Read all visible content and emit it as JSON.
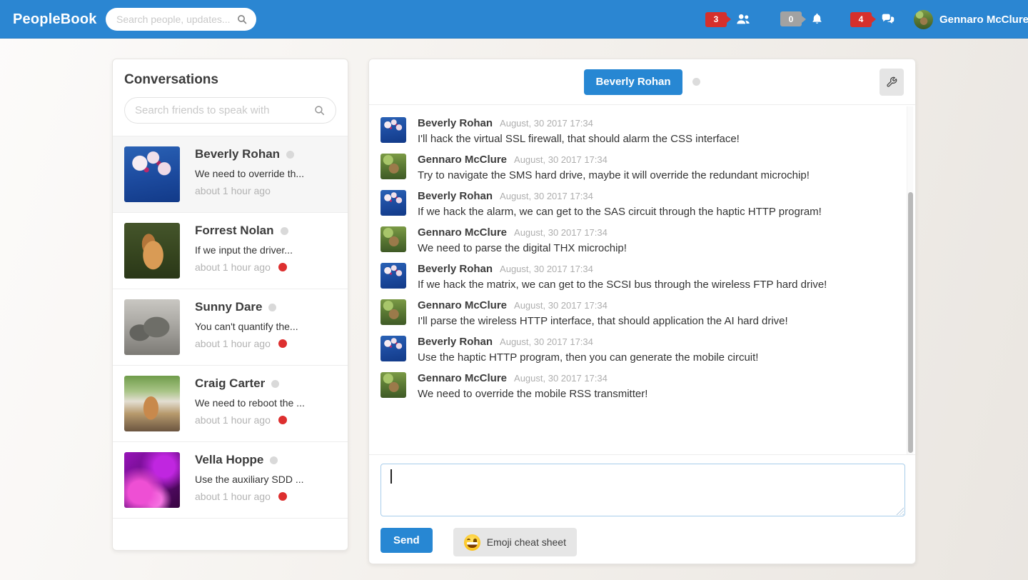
{
  "navbar": {
    "brand": "PeopleBook",
    "search_placeholder": "Search people, updates...",
    "badges": [
      {
        "count": "3",
        "icon": "users-icon",
        "color": "#d6302c"
      },
      {
        "count": "0",
        "icon": "bell-icon",
        "color": "#a2a2a2"
      },
      {
        "count": "4",
        "icon": "chat-icon",
        "color": "#d6302c"
      }
    ],
    "user": {
      "name": "Gennaro McClure",
      "avatar": "turtle"
    }
  },
  "conversations": {
    "title": "Conversations",
    "search_placeholder": "Search friends to speak with",
    "items": [
      {
        "name": "Beverly Rohan",
        "avatar": "orchid",
        "preview": "We need to override th...",
        "time": "about 1 hour ago",
        "unread": false,
        "selected": true
      },
      {
        "name": "Forrest Nolan",
        "avatar": "horse",
        "preview": "If we input the driver...",
        "time": "about 1 hour ago",
        "unread": true,
        "selected": false
      },
      {
        "name": "Sunny Dare",
        "avatar": "rhino",
        "preview": "You can't quantify the...",
        "time": "about 1 hour ago",
        "unread": true,
        "selected": false
      },
      {
        "name": "Craig Carter",
        "avatar": "dog",
        "preview": "We need to reboot the ...",
        "time": "about 1 hour ago",
        "unread": true,
        "selected": false
      },
      {
        "name": "Vella Hoppe",
        "avatar": "purple",
        "preview": "Use the auxiliary SDD ...",
        "time": "about 1 hour ago",
        "unread": true,
        "selected": false
      }
    ]
  },
  "chat": {
    "peer_name": "Beverly Rohan",
    "messages": [
      {
        "author": "Beverly Rohan",
        "avatar": "orchid",
        "timestamp": "August, 30 2017 17:34",
        "text": "I'll hack the virtual SSL firewall, that should alarm the CSS interface!"
      },
      {
        "author": "Gennaro McClure",
        "avatar": "turtle",
        "timestamp": "August, 30 2017 17:34",
        "text": "Try to navigate the SMS hard drive, maybe it will override the redundant microchip!"
      },
      {
        "author": "Beverly Rohan",
        "avatar": "orchid",
        "timestamp": "August, 30 2017 17:34",
        "text": "If we hack the alarm, we can get to the SAS circuit through the haptic HTTP program!"
      },
      {
        "author": "Gennaro McClure",
        "avatar": "turtle",
        "timestamp": "August, 30 2017 17:34",
        "text": "We need to parse the digital THX microchip!"
      },
      {
        "author": "Beverly Rohan",
        "avatar": "orchid",
        "timestamp": "August, 30 2017 17:34",
        "text": "If we hack the matrix, we can get to the SCSI bus through the wireless FTP hard drive!"
      },
      {
        "author": "Gennaro McClure",
        "avatar": "turtle",
        "timestamp": "August, 30 2017 17:34",
        "text": "I'll parse the wireless HTTP interface, that should application the AI hard drive!"
      },
      {
        "author": "Beverly Rohan",
        "avatar": "orchid",
        "timestamp": "August, 30 2017 17:34",
        "text": "Use the haptic HTTP program, then you can generate the mobile circuit!"
      },
      {
        "author": "Gennaro McClure",
        "avatar": "turtle",
        "timestamp": "August, 30 2017 17:34",
        "text": "We need to override the mobile RSS transmitter!"
      }
    ],
    "composer": {
      "input_value": "",
      "send_label": "Send",
      "emoji_label": "Emoji cheat sheet",
      "emoji_icon": "grinning-emoji-icon"
    }
  },
  "colors": {
    "navbar_blue": "#2b86d2",
    "accent_blue": "#2787d3",
    "badge_red": "#d6302c",
    "badge_gray": "#a2a2a2",
    "unread_red": "#dd2f2f"
  }
}
